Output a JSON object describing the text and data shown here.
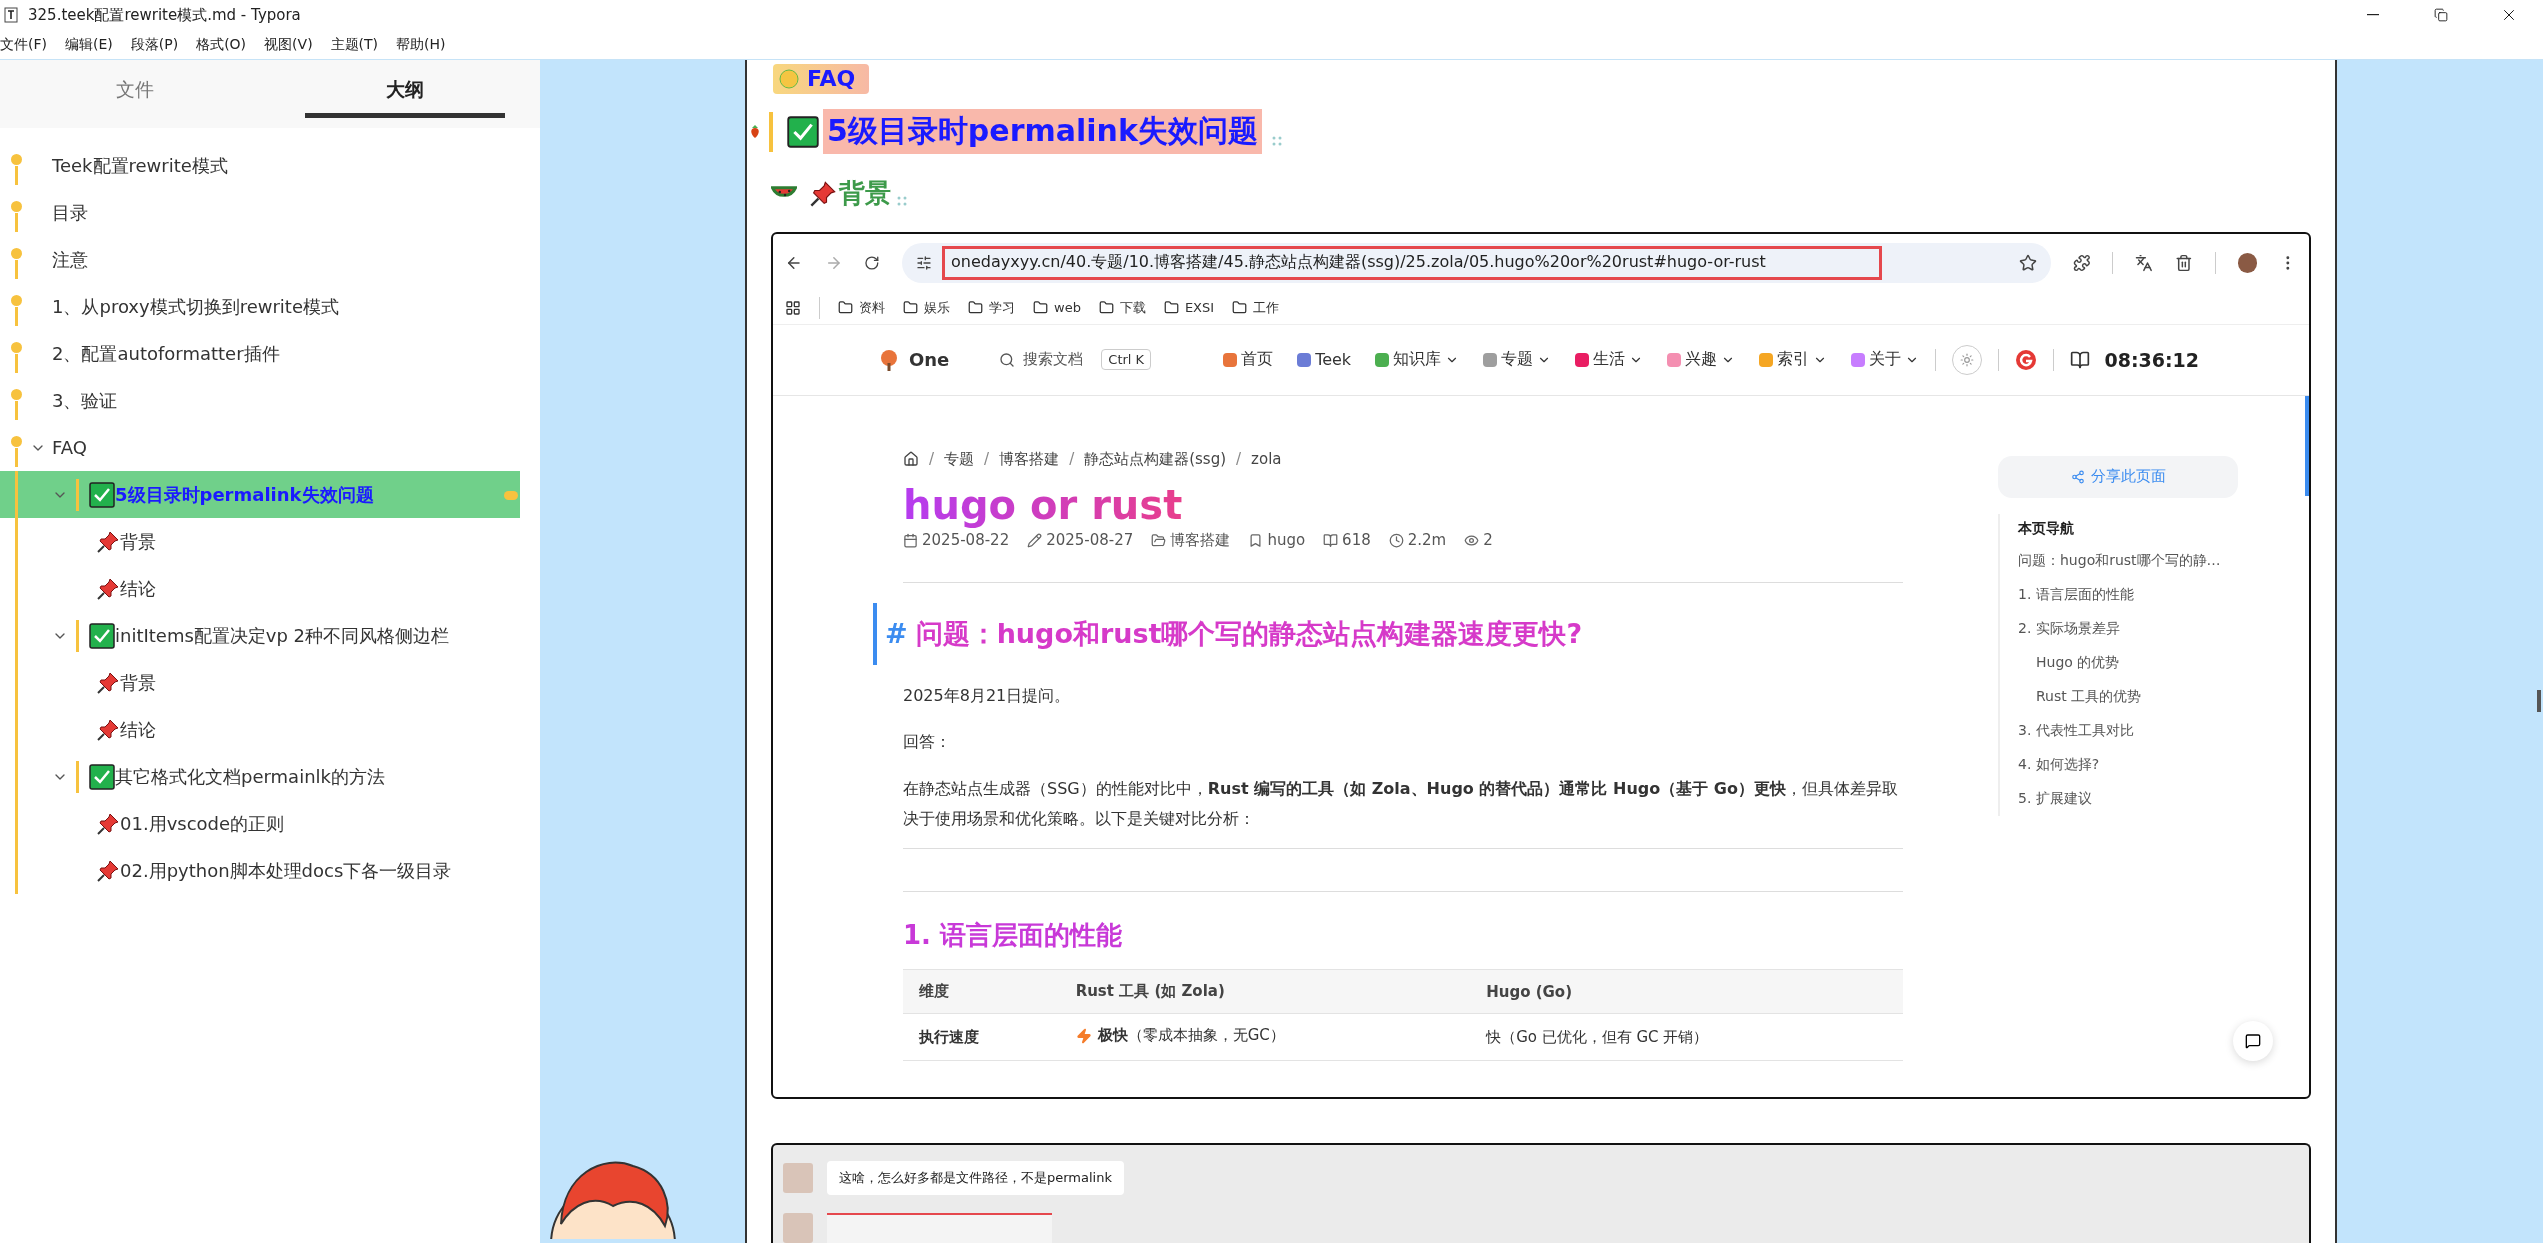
{
  "window": {
    "title": "325.teek配置rewrite模式.md - Typora"
  },
  "menu": [
    "文件(F)",
    "编辑(E)",
    "段落(P)",
    "格式(O)",
    "视图(V)",
    "主题(T)",
    "帮助(H)"
  ],
  "sidebar": {
    "tabs": [
      {
        "label": "文件",
        "selected": false
      },
      {
        "label": "大纲",
        "selected": true
      }
    ],
    "outline": [
      {
        "text": "Teek配置rewrite模式",
        "selected": false
      },
      {
        "text": "目录",
        "selected": false
      },
      {
        "text": "注意",
        "selected": false
      },
      {
        "text": "1、从proxy模式切换到rewrite模式",
        "selected": false
      },
      {
        "text": "2、配置autoformatter插件",
        "selected": false
      },
      {
        "text": "3、验证",
        "selected": false
      },
      {
        "text": "FAQ",
        "selected": false,
        "expanded": true,
        "children": [
          {
            "text": "5级目录时permalink失效问题",
            "kind": "check",
            "selected": true,
            "expanded": true,
            "children": [
              {
                "text": "背景",
                "kind": "pin",
                "selected": false
              },
              {
                "text": "结论",
                "kind": "pin",
                "selected": false
              }
            ]
          },
          {
            "text": "initItems配置决定vp 2种不同风格侧边栏",
            "kind": "check",
            "selected": false,
            "expanded": true,
            "children": [
              {
                "text": "背景",
                "kind": "pin",
                "selected": false
              },
              {
                "text": "结论",
                "kind": "pin",
                "selected": false
              }
            ]
          },
          {
            "text": "其它格式化文档permainlk的方法",
            "kind": "check",
            "selected": false,
            "expanded": true,
            "children": [
              {
                "text": "01.用vscode的正则",
                "kind": "pin",
                "selected": false
              },
              {
                "text": "02.用python脚本处理docs下各一级目录",
                "kind": "pin",
                "selected": false
              }
            ]
          }
        ]
      }
    ]
  },
  "editor": {
    "faq_heading": "FAQ",
    "heading": "5级目录时permalink失效问题",
    "subheading": "背景",
    "browser": {
      "url": "onedayxyy.cn/40.专题/10.博客搭建/45.静态站点构建器(ssg)/25.zola/05.hugo%20or%20rust#hugo-or-rust",
      "bookmarks": [
        "资料",
        "娱乐",
        "学习",
        "web",
        "下载",
        "EXSI",
        "工作"
      ],
      "site": {
        "brand": "One",
        "search_placeholder": "搜索文档",
        "shortcut": "Ctrl K",
        "nav": [
          {
            "label": "首页",
            "dropdown": false,
            "color": "#e8743b"
          },
          {
            "label": "Teek",
            "dropdown": false,
            "color": "#6b7cd6"
          },
          {
            "label": "知识库",
            "dropdown": true,
            "color": "#4caf50"
          },
          {
            "label": "专题",
            "dropdown": true,
            "color": "#9e9e9e"
          },
          {
            "label": "生活",
            "dropdown": true,
            "color": "#e91e63"
          },
          {
            "label": "兴趣",
            "dropdown": true,
            "color": "#f48fb1"
          },
          {
            "label": "索引",
            "dropdown": true,
            "color": "#f5a623"
          },
          {
            "label": "关于",
            "dropdown": true,
            "color": "#c77dff"
          }
        ],
        "time": "08:36:12"
      },
      "page": {
        "breadcrumb_separator": "/",
        "breadcrumb": [
          "专题",
          "博客搭建",
          "静态站点构建器(ssg)",
          "zola"
        ],
        "title": "hugo or rust",
        "meta": [
          {
            "kind": "created",
            "text": "2025-08-22"
          },
          {
            "kind": "updated",
            "text": "2025-08-27"
          },
          {
            "kind": "category",
            "text": "博客搭建"
          },
          {
            "kind": "tag",
            "text": "hugo"
          },
          {
            "kind": "words",
            "text": "618"
          },
          {
            "kind": "time",
            "text": "2.2m"
          },
          {
            "kind": "views",
            "text": "2"
          }
        ],
        "anchor": "#",
        "heading": "问题：hugo和rust哪个写的静态站点构建器速度更快?",
        "paragraphs": [
          "2025年8月21日提问。",
          "回答：",
          "在静态站点生成器（SSG）的性能对比中，**Rust 编写的工具（如 Zola、Hugo 的替代品）通常比 Hugo（基于 Go）更快**，但具体差异取决于使用场景和优化策略。以下是关键对比分析："
        ],
        "section": "1. 语言层面的性能",
        "table": {
          "columns": [
            "维度",
            "Rust 工具 (如 Zola)",
            "Hugo (Go)"
          ],
          "rows": [
            {
              "cells": [
                "执行速度",
                "**极快**（零成本抽象，无GC）",
                "快（Go 已优化，但有 GC 开销）"
              ],
              "kind": "bolt"
            }
          ]
        }
      },
      "toc": {
        "share": "分享此页面",
        "title": "本页导航",
        "items": [
          {
            "text": "问题：hugo和rust哪个写的静…"
          },
          {
            "text": "1. 语言层面的性能"
          },
          {
            "text": "2. 实际场景差异",
            "children": [
              {
                "text": "Hugo 的优势"
              },
              {
                "text": "Rust 工具的优势"
              }
            ]
          },
          {
            "text": "3. 代表性工具对比"
          },
          {
            "text": "4. 如何选择?"
          },
          {
            "text": "5. 扩展建议"
          }
        ]
      }
    },
    "chat": {
      "messages": [
        {
          "kind": "text",
          "text": "这啥，怎么好多都是文件路径，不是permalink"
        },
        {
          "kind": "image"
        }
      ]
    }
  }
}
